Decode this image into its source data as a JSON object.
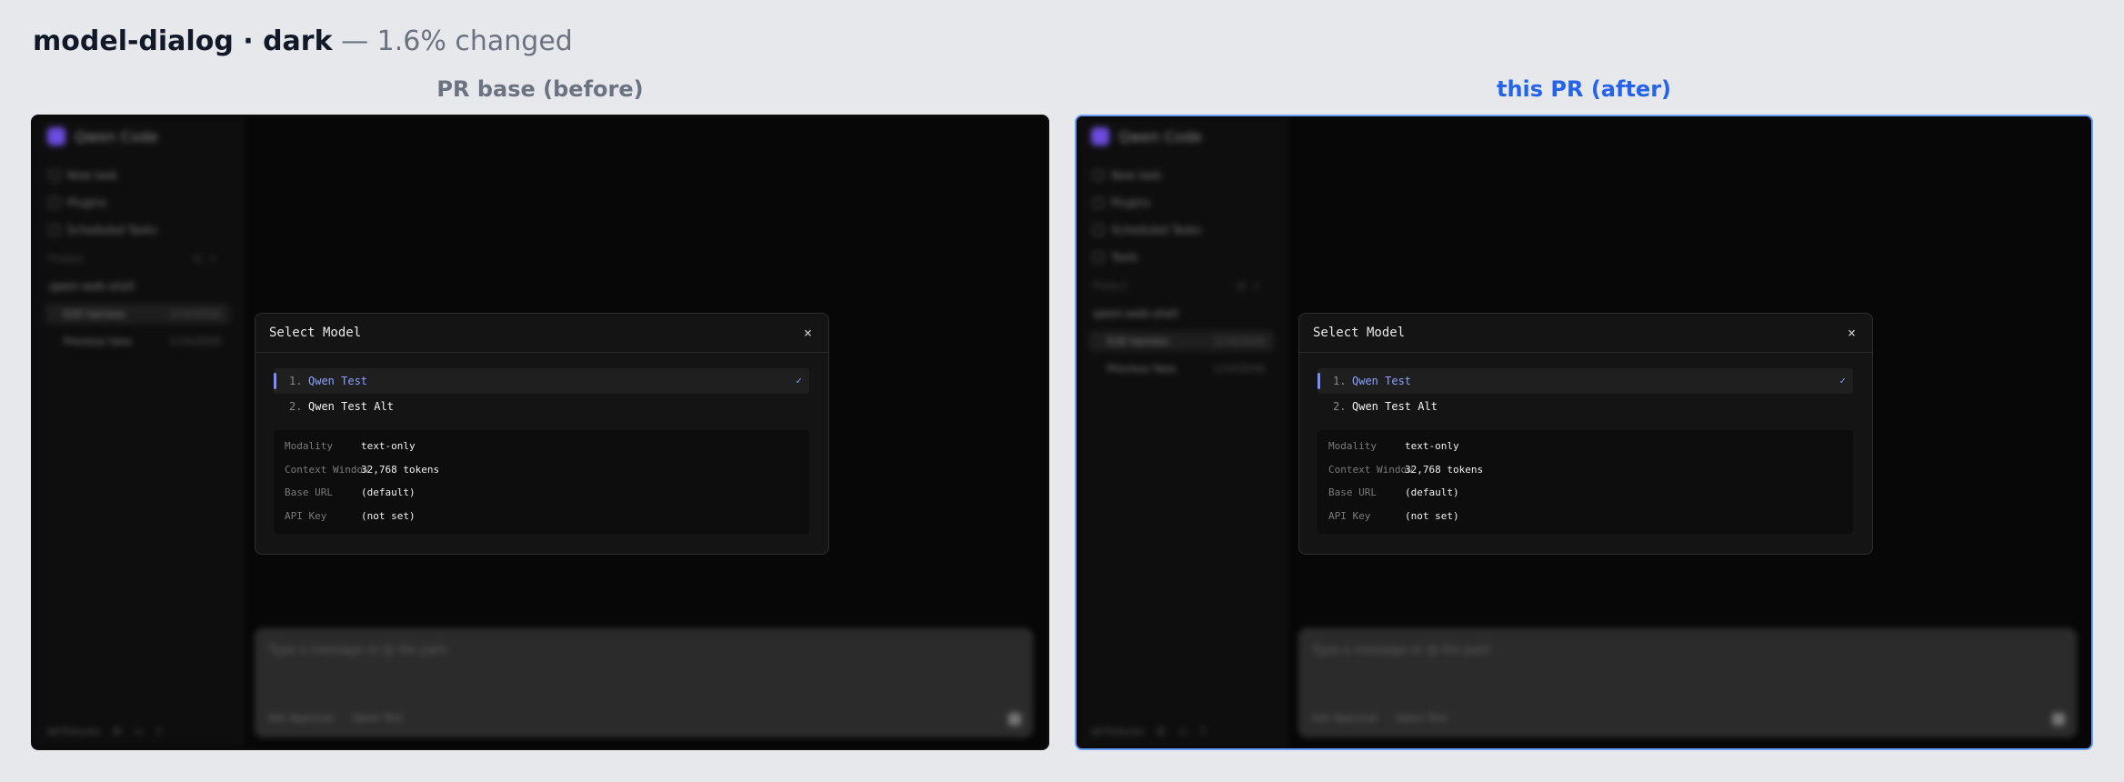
{
  "heading": {
    "title": "model-dialog · dark",
    "subtitle": " — 1.6% changed"
  },
  "panels": {
    "before_label": "PR base (before)",
    "after_label": "this PR (after)"
  },
  "app": {
    "brand": "Qwen Code",
    "composer_placeholder": "Type a message or @ file path",
    "approval_chip": "Ask Approval",
    "model_chip": "Qwen Test",
    "footer_label": "wf-fixtures"
  },
  "before": {
    "sidebar": [
      {
        "label": "New task",
        "icon": "new-task-icon"
      },
      {
        "label": "Plugins",
        "icon": "plugins-icon"
      },
      {
        "label": "Scheduled Tasks",
        "icon": "clock-icon"
      }
    ],
    "project_header": "Project",
    "folder": "qwen-web-shell",
    "sessions": [
      {
        "label": "E2E harness",
        "time": "1/14/2026",
        "active": true
      },
      {
        "label": "Previous Sess",
        "time": "1/14/2026",
        "active": false
      }
    ]
  },
  "after": {
    "sidebar": [
      {
        "label": "New task",
        "icon": "new-task-icon"
      },
      {
        "label": "Plugins",
        "icon": "plugins-icon"
      },
      {
        "label": "Scheduled Tasks",
        "icon": "clock-icon"
      },
      {
        "label": "Tools",
        "icon": "tools-icon"
      }
    ],
    "project_header": "Project",
    "folder": "qwen-web-shell",
    "sessions": [
      {
        "label": "E2E harness",
        "time": "1/14/2026",
        "active": true
      },
      {
        "label": "Previous Sess",
        "time": "1/14/2026",
        "active": false
      }
    ]
  },
  "dialog": {
    "title": "Select Model",
    "close": "×",
    "options": [
      {
        "num": "1.",
        "name": "Qwen Test",
        "selected": true,
        "check": "✓"
      },
      {
        "num": "2.",
        "name": "Qwen Test Alt",
        "selected": false,
        "check": ""
      }
    ],
    "details": [
      {
        "key": "Modality",
        "value": "text-only"
      },
      {
        "key": "Context Window",
        "value": "32,768 tokens"
      },
      {
        "key": "Base URL",
        "value": "(default)"
      },
      {
        "key": "API Key",
        "value": "(not set)"
      }
    ]
  },
  "colors": {
    "accent": "#7c8cff",
    "before_label": "#6b7280",
    "after_label": "#2563eb",
    "after_border": "#6b9ff7"
  }
}
